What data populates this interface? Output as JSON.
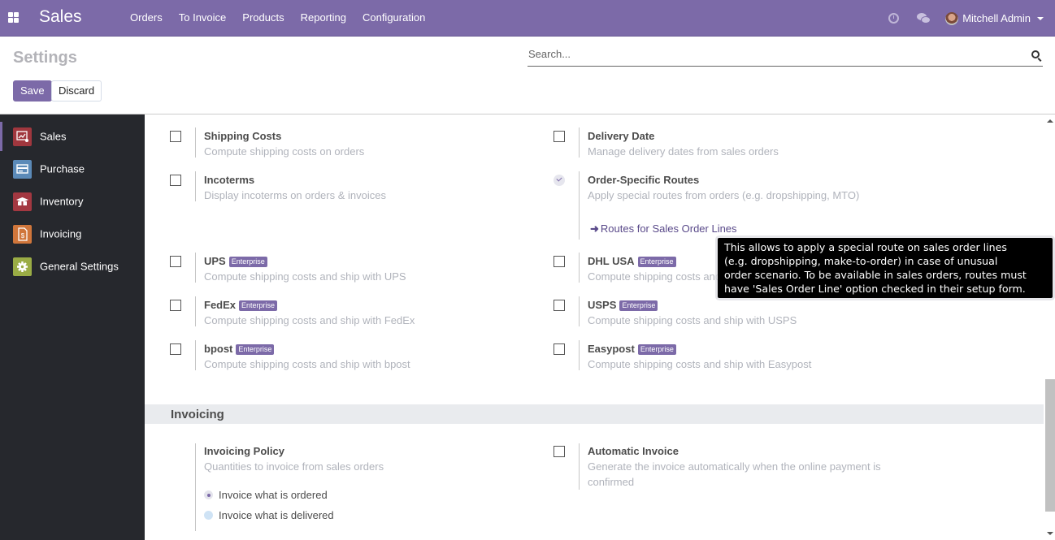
{
  "navbar": {
    "app_name": "Sales",
    "menu": [
      "Orders",
      "To Invoice",
      "Products",
      "Reporting",
      "Configuration"
    ],
    "user": "Mitchell Admin",
    "icons": [
      "apps-icon",
      "clock-icon",
      "chat-icon",
      "avatar",
      "caret-down-icon"
    ],
    "accent_color": "#7c6aa8"
  },
  "control": {
    "title": "Settings",
    "search_placeholder": "Search...",
    "save_label": "Save",
    "discard_label": "Discard"
  },
  "sidebar": {
    "items": [
      {
        "label": "Sales",
        "icon": "sales-chart-icon",
        "color": "#a0373e",
        "active": true
      },
      {
        "label": "Purchase",
        "icon": "purchase-card-icon",
        "color": "#5b8ab8",
        "active": false
      },
      {
        "label": "Inventory",
        "icon": "inventory-box-icon",
        "color": "#a33841",
        "active": false
      },
      {
        "label": "Invoicing",
        "icon": "invoice-dollar-icon",
        "color": "#d0763b",
        "active": false
      },
      {
        "label": "General Settings",
        "icon": "gear-icon",
        "color": "#9aac45",
        "active": false
      }
    ]
  },
  "settings": {
    "shipping_costs": {
      "title": "Shipping Costs",
      "desc": "Compute shipping costs on orders",
      "checked": false
    },
    "delivery_date": {
      "title": "Delivery Date",
      "desc": "Manage delivery dates from sales orders",
      "checked": false
    },
    "incoterms": {
      "title": "Incoterms",
      "desc": "Display incoterms on orders & invoices",
      "checked": false
    },
    "order_routes": {
      "title": "Order-Specific Routes",
      "desc": "Apply special routes from orders (e.g. dropshipping, MTO)",
      "checked": true,
      "link": "Routes for Sales Order Lines"
    },
    "ups": {
      "title": "UPS",
      "badge": "Enterprise",
      "desc": "Compute shipping costs and ship with UPS",
      "checked": false
    },
    "dhl": {
      "title": "DHL USA",
      "badge": "Enterprise",
      "desc": "Compute shipping costs and ship with DHL USA",
      "checked": false
    },
    "fedex": {
      "title": "FedEx",
      "badge": "Enterprise",
      "desc": "Compute shipping costs and ship with FedEx",
      "checked": false
    },
    "usps": {
      "title": "USPS",
      "badge": "Enterprise",
      "desc": "Compute shipping costs and ship with USPS",
      "checked": false
    },
    "bpost": {
      "title": "bpost",
      "badge": "Enterprise",
      "desc": "Compute shipping costs and ship with bpost",
      "checked": false
    },
    "easypost": {
      "title": "Easypost",
      "badge": "Enterprise",
      "desc": "Compute shipping costs and ship with Easypost",
      "checked": false
    }
  },
  "invoicing": {
    "section_title": "Invoicing",
    "policy": {
      "title": "Invoicing Policy",
      "desc": "Quantities to invoice from sales orders",
      "options": [
        {
          "label": "Invoice what is ordered",
          "selected": true
        },
        {
          "label": "Invoice what is delivered",
          "selected": false
        }
      ]
    },
    "automatic": {
      "title": "Automatic Invoice",
      "desc_line1": "Generate the invoice automatically when the online payment is",
      "desc_line2": "confirmed",
      "checked": false
    }
  },
  "tooltip": {
    "lines": [
      "This allows to apply a special route on sales order lines",
      "(e.g. dropshipping, make-to-order) in case of unusual",
      "order scenario. To be available in sales orders, routes must",
      "have 'Sales Order Line' option checked in their setup form."
    ]
  }
}
